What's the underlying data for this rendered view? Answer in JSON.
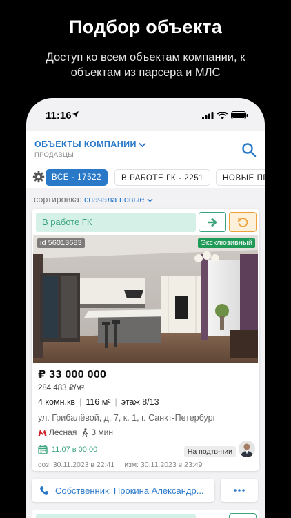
{
  "promo": {
    "title": "Подбор объекта",
    "subtitle": "Доступ ко всем объектам компании, к объектам из парсера и МЛС"
  },
  "status_bar": {
    "time": "11:16"
  },
  "header": {
    "section": "ОБЪЕКТЫ КОМПАНИИ",
    "subsection": "ПРОДАВЦЫ",
    "icons": [
      "chevron-down-icon",
      "search-icon"
    ]
  },
  "filters": {
    "chips": [
      "ВСЕ - 17522",
      "В РАБОТЕ ГК - 2251",
      "НОВЫЕ ПР"
    ],
    "active_index": 0
  },
  "sort": {
    "label": "сортировка:",
    "value": "сначала новые"
  },
  "listing": {
    "status": "В работе ГК",
    "id_label": "id 56013683",
    "badge": "Эксклюзивный",
    "price": "₽ 33 000 000",
    "price_per_m2": "284 483 ₽/м²",
    "rooms": "4 комн.кв",
    "area": "116 м²",
    "floor": "этаж 8/13",
    "address": "ул. Грибалёвой, д. 7, к. 1, г. Санкт-Петербург",
    "metro": "Лесная",
    "walk": "3 мин",
    "next_date": "11.07 в 00:00",
    "state": "На подтв-нии",
    "created": "соз: 30.11.2023 в 22:41",
    "modified": "изм: 30.11.2023 в 23:49",
    "owner": "Собственник: Прокина Александр...",
    "colors": {
      "accent": "#2a79c9",
      "green": "#3aa37c",
      "orange": "#eea23c",
      "exclusive": "#1f9a57"
    }
  }
}
